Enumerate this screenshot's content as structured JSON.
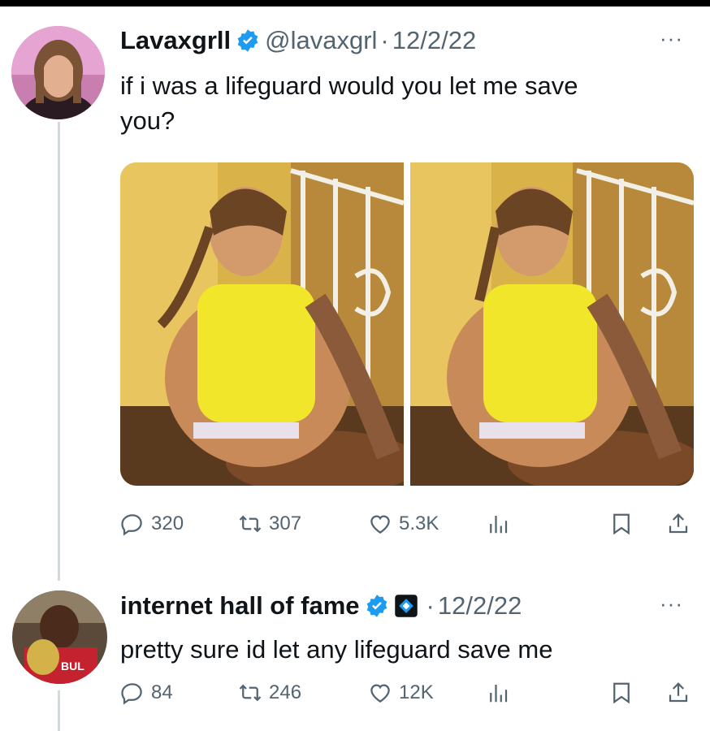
{
  "tweets": [
    {
      "display_name": "Lavaxgrll",
      "handle": "@lavaxgrl",
      "separator": "·",
      "date": "12/2/22",
      "text_line1": "if i was a lifeguard would you let me save",
      "text_line2": "you?",
      "stats": {
        "replies": "320",
        "retweets": "307",
        "likes": "5.3K"
      }
    },
    {
      "display_name": "internet hall of fame",
      "separator": "·",
      "date": "12/2/22",
      "text_line1": "pretty sure id let any lifeguard save me",
      "stats": {
        "replies": "84",
        "retweets": "246",
        "likes": "12K"
      }
    }
  ],
  "icons": [
    "verified-badge-icon",
    "affiliate-badge-icon",
    "more-icon",
    "reply-icon",
    "retweet-icon",
    "like-icon",
    "views-icon",
    "bookmark-icon",
    "share-icon"
  ],
  "colors": {
    "accent": "#1d9bf0",
    "muted": "#536471",
    "text": "#0f1419",
    "thread_line": "#cfd9de"
  }
}
